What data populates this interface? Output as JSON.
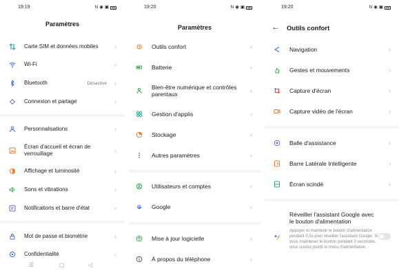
{
  "screens": [
    {
      "time": "19:19",
      "title": "Paramètres",
      "items": [
        {
          "label": "Carte SIM et données mobiles",
          "value": ""
        },
        {
          "label": "Wi-Fi",
          "value": ""
        },
        {
          "label": "Bluetooth",
          "value": "Désactivé"
        },
        {
          "label": "Connexion et partage",
          "value": ""
        },
        {
          "label": "Personnalisations",
          "value": ""
        },
        {
          "label": "Écran d'accueil et écran de verrouillage",
          "value": ""
        },
        {
          "label": "Affichage et luminosité",
          "value": ""
        },
        {
          "label": "Sons et vibrations",
          "value": ""
        },
        {
          "label": "Notifications et barre d'état",
          "value": ""
        },
        {
          "label": "Mot de passe et biométrie",
          "value": ""
        },
        {
          "label": "Confidentialité",
          "value": ""
        }
      ]
    },
    {
      "time": "19:20",
      "title": "Paramètres",
      "items": [
        {
          "label": "Outils confort"
        },
        {
          "label": "Batterie"
        },
        {
          "label": "Bien-être numérique et contrôles parentaux"
        },
        {
          "label": "Gestion d'applis"
        },
        {
          "label": "Stockage"
        },
        {
          "label": "Autres paramètres"
        },
        {
          "label": "Utilisateurs et comptes"
        },
        {
          "label": "Google"
        },
        {
          "label": "Mise à jour logicielle"
        },
        {
          "label": "À propos du téléphone"
        }
      ]
    },
    {
      "time": "19:20",
      "title": "Outils confort",
      "items": [
        {
          "label": "Navigation"
        },
        {
          "label": "Gestes et mouvements"
        },
        {
          "label": "Capture d'écran"
        },
        {
          "label": "Capture vidéo de l'écran"
        },
        {
          "label": "Balle d'assistance"
        },
        {
          "label": "Barre Latérale Intelligente"
        },
        {
          "label": "Écran scindé"
        },
        {
          "label": "Réveiller l'assistant Google avec le bouton d'alimentation"
        }
      ],
      "google_desc": "Appuyer et maintenir le bouton d'alimentation pendant 0,5s pour réveiller l'assistant Google. Si vous maintenez le bouton pendant 3 secondes, vous ouvrez plutôt le menu d'alimentation."
    }
  ],
  "navbar": {
    "menu": "☰",
    "home": "▢",
    "back": "◁"
  },
  "colors": {
    "accent_orange": "#f07a2b",
    "accent_green": "#3aa757",
    "accent_blue": "#3b6fe0",
    "accent_purple": "#7b5cd6",
    "accent_red": "#e8453c",
    "accent_teal": "#20a89a"
  }
}
